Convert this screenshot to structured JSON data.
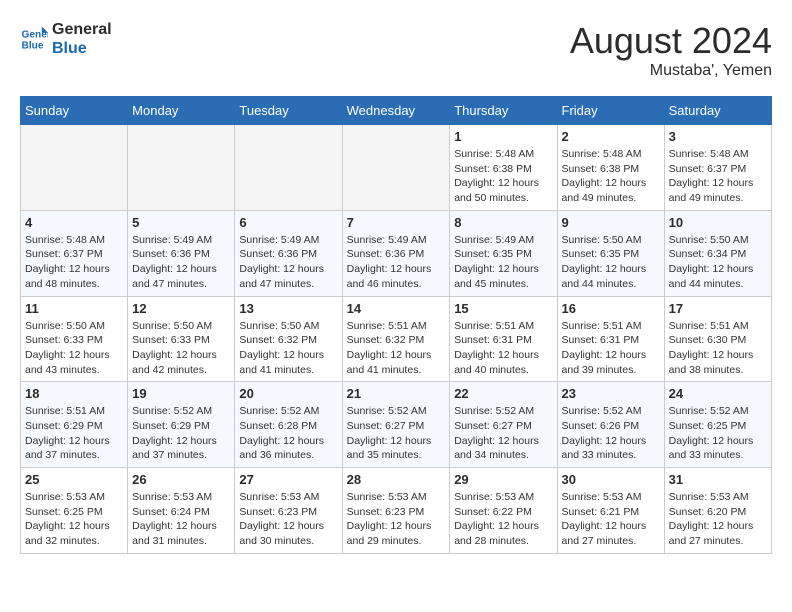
{
  "header": {
    "logo_line1": "General",
    "logo_line2": "Blue",
    "month_title": "August 2024",
    "location": "Mustaba', Yemen"
  },
  "weekdays": [
    "Sunday",
    "Monday",
    "Tuesday",
    "Wednesday",
    "Thursday",
    "Friday",
    "Saturday"
  ],
  "weeks": [
    [
      {
        "day": "",
        "info": ""
      },
      {
        "day": "",
        "info": ""
      },
      {
        "day": "",
        "info": ""
      },
      {
        "day": "",
        "info": ""
      },
      {
        "day": "1",
        "info": "Sunrise: 5:48 AM\nSunset: 6:38 PM\nDaylight: 12 hours\nand 50 minutes."
      },
      {
        "day": "2",
        "info": "Sunrise: 5:48 AM\nSunset: 6:38 PM\nDaylight: 12 hours\nand 49 minutes."
      },
      {
        "day": "3",
        "info": "Sunrise: 5:48 AM\nSunset: 6:37 PM\nDaylight: 12 hours\nand 49 minutes."
      }
    ],
    [
      {
        "day": "4",
        "info": "Sunrise: 5:48 AM\nSunset: 6:37 PM\nDaylight: 12 hours\nand 48 minutes."
      },
      {
        "day": "5",
        "info": "Sunrise: 5:49 AM\nSunset: 6:36 PM\nDaylight: 12 hours\nand 47 minutes."
      },
      {
        "day": "6",
        "info": "Sunrise: 5:49 AM\nSunset: 6:36 PM\nDaylight: 12 hours\nand 47 minutes."
      },
      {
        "day": "7",
        "info": "Sunrise: 5:49 AM\nSunset: 6:36 PM\nDaylight: 12 hours\nand 46 minutes."
      },
      {
        "day": "8",
        "info": "Sunrise: 5:49 AM\nSunset: 6:35 PM\nDaylight: 12 hours\nand 45 minutes."
      },
      {
        "day": "9",
        "info": "Sunrise: 5:50 AM\nSunset: 6:35 PM\nDaylight: 12 hours\nand 44 minutes."
      },
      {
        "day": "10",
        "info": "Sunrise: 5:50 AM\nSunset: 6:34 PM\nDaylight: 12 hours\nand 44 minutes."
      }
    ],
    [
      {
        "day": "11",
        "info": "Sunrise: 5:50 AM\nSunset: 6:33 PM\nDaylight: 12 hours\nand 43 minutes."
      },
      {
        "day": "12",
        "info": "Sunrise: 5:50 AM\nSunset: 6:33 PM\nDaylight: 12 hours\nand 42 minutes."
      },
      {
        "day": "13",
        "info": "Sunrise: 5:50 AM\nSunset: 6:32 PM\nDaylight: 12 hours\nand 41 minutes."
      },
      {
        "day": "14",
        "info": "Sunrise: 5:51 AM\nSunset: 6:32 PM\nDaylight: 12 hours\nand 41 minutes."
      },
      {
        "day": "15",
        "info": "Sunrise: 5:51 AM\nSunset: 6:31 PM\nDaylight: 12 hours\nand 40 minutes."
      },
      {
        "day": "16",
        "info": "Sunrise: 5:51 AM\nSunset: 6:31 PM\nDaylight: 12 hours\nand 39 minutes."
      },
      {
        "day": "17",
        "info": "Sunrise: 5:51 AM\nSunset: 6:30 PM\nDaylight: 12 hours\nand 38 minutes."
      }
    ],
    [
      {
        "day": "18",
        "info": "Sunrise: 5:51 AM\nSunset: 6:29 PM\nDaylight: 12 hours\nand 37 minutes."
      },
      {
        "day": "19",
        "info": "Sunrise: 5:52 AM\nSunset: 6:29 PM\nDaylight: 12 hours\nand 37 minutes."
      },
      {
        "day": "20",
        "info": "Sunrise: 5:52 AM\nSunset: 6:28 PM\nDaylight: 12 hours\nand 36 minutes."
      },
      {
        "day": "21",
        "info": "Sunrise: 5:52 AM\nSunset: 6:27 PM\nDaylight: 12 hours\nand 35 minutes."
      },
      {
        "day": "22",
        "info": "Sunrise: 5:52 AM\nSunset: 6:27 PM\nDaylight: 12 hours\nand 34 minutes."
      },
      {
        "day": "23",
        "info": "Sunrise: 5:52 AM\nSunset: 6:26 PM\nDaylight: 12 hours\nand 33 minutes."
      },
      {
        "day": "24",
        "info": "Sunrise: 5:52 AM\nSunset: 6:25 PM\nDaylight: 12 hours\nand 33 minutes."
      }
    ],
    [
      {
        "day": "25",
        "info": "Sunrise: 5:53 AM\nSunset: 6:25 PM\nDaylight: 12 hours\nand 32 minutes."
      },
      {
        "day": "26",
        "info": "Sunrise: 5:53 AM\nSunset: 6:24 PM\nDaylight: 12 hours\nand 31 minutes."
      },
      {
        "day": "27",
        "info": "Sunrise: 5:53 AM\nSunset: 6:23 PM\nDaylight: 12 hours\nand 30 minutes."
      },
      {
        "day": "28",
        "info": "Sunrise: 5:53 AM\nSunset: 6:23 PM\nDaylight: 12 hours\nand 29 minutes."
      },
      {
        "day": "29",
        "info": "Sunrise: 5:53 AM\nSunset: 6:22 PM\nDaylight: 12 hours\nand 28 minutes."
      },
      {
        "day": "30",
        "info": "Sunrise: 5:53 AM\nSunset: 6:21 PM\nDaylight: 12 hours\nand 27 minutes."
      },
      {
        "day": "31",
        "info": "Sunrise: 5:53 AM\nSunset: 6:20 PM\nDaylight: 12 hours\nand 27 minutes."
      }
    ]
  ]
}
